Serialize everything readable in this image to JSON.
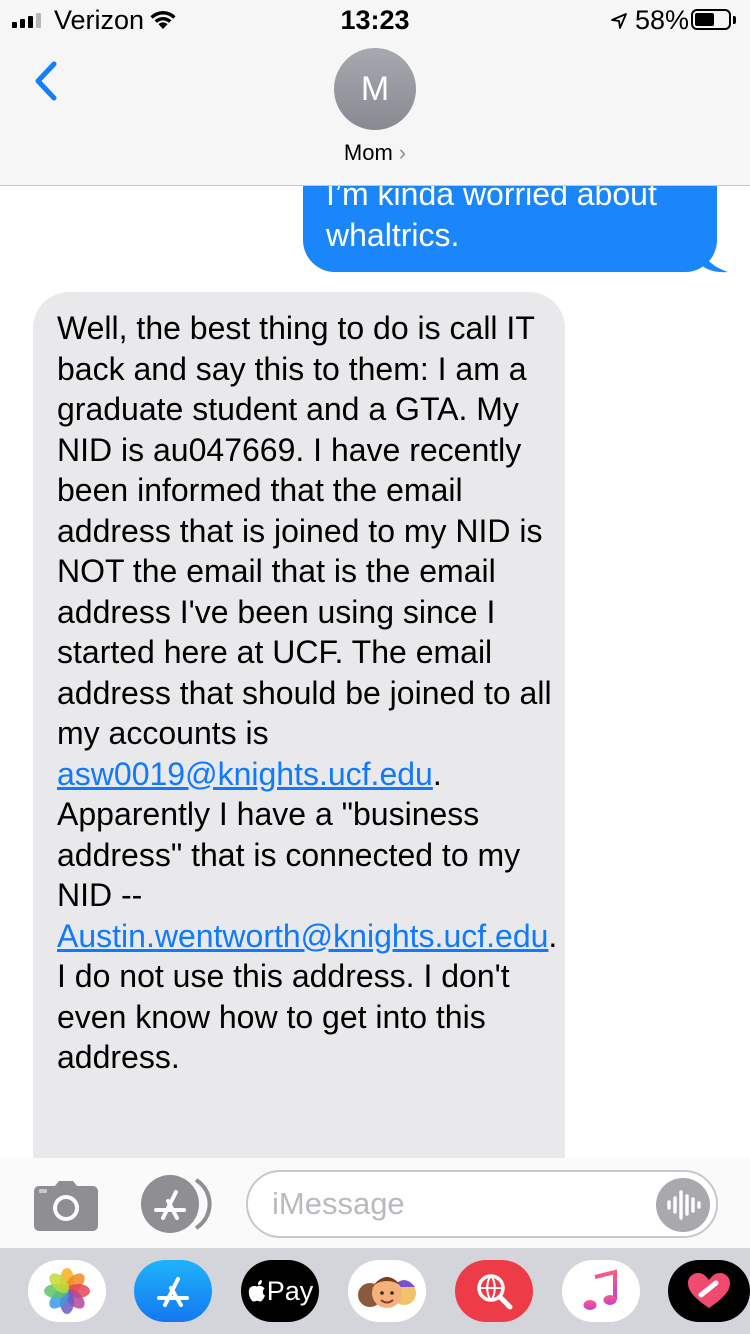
{
  "status_bar": {
    "carrier": "Verizon",
    "time": "13:23",
    "battery": "58%",
    "battery_level": 0.58
  },
  "header": {
    "avatar_initial": "M",
    "contact_name": "Mom",
    "chevron": "›"
  },
  "messages": {
    "outgoing": "I’m kinda worried about whaltrics.",
    "incoming_part1": "Well, the best thing to do is call IT back and say this to them:  I am a graduate student and a GTA.  My NID is au047669.  I have recently been informed that the email address that is joined to my NID is NOT the email that is the email address I've been using since I started here at UCF.  The email address that should be joined to all my accounts is ",
    "incoming_link1": "asw0019@knights.ucf.edu",
    "incoming_part2": ". Apparently I have a \"business address\" that is connected to my NID -- ",
    "incoming_link2": "Austin.wentworth@knights.ucf.edu",
    "incoming_part3": ".   I do not use this address.  I don't even know how to get into this address."
  },
  "compose": {
    "placeholder": "iMessage"
  },
  "drawer": {
    "pay_label": "Pay"
  },
  "colors": {
    "outgoing_bubble": "#1b86f9",
    "incoming_bubble": "#e9e9eb",
    "link": "#0f7afb",
    "accent": "#147efb"
  }
}
